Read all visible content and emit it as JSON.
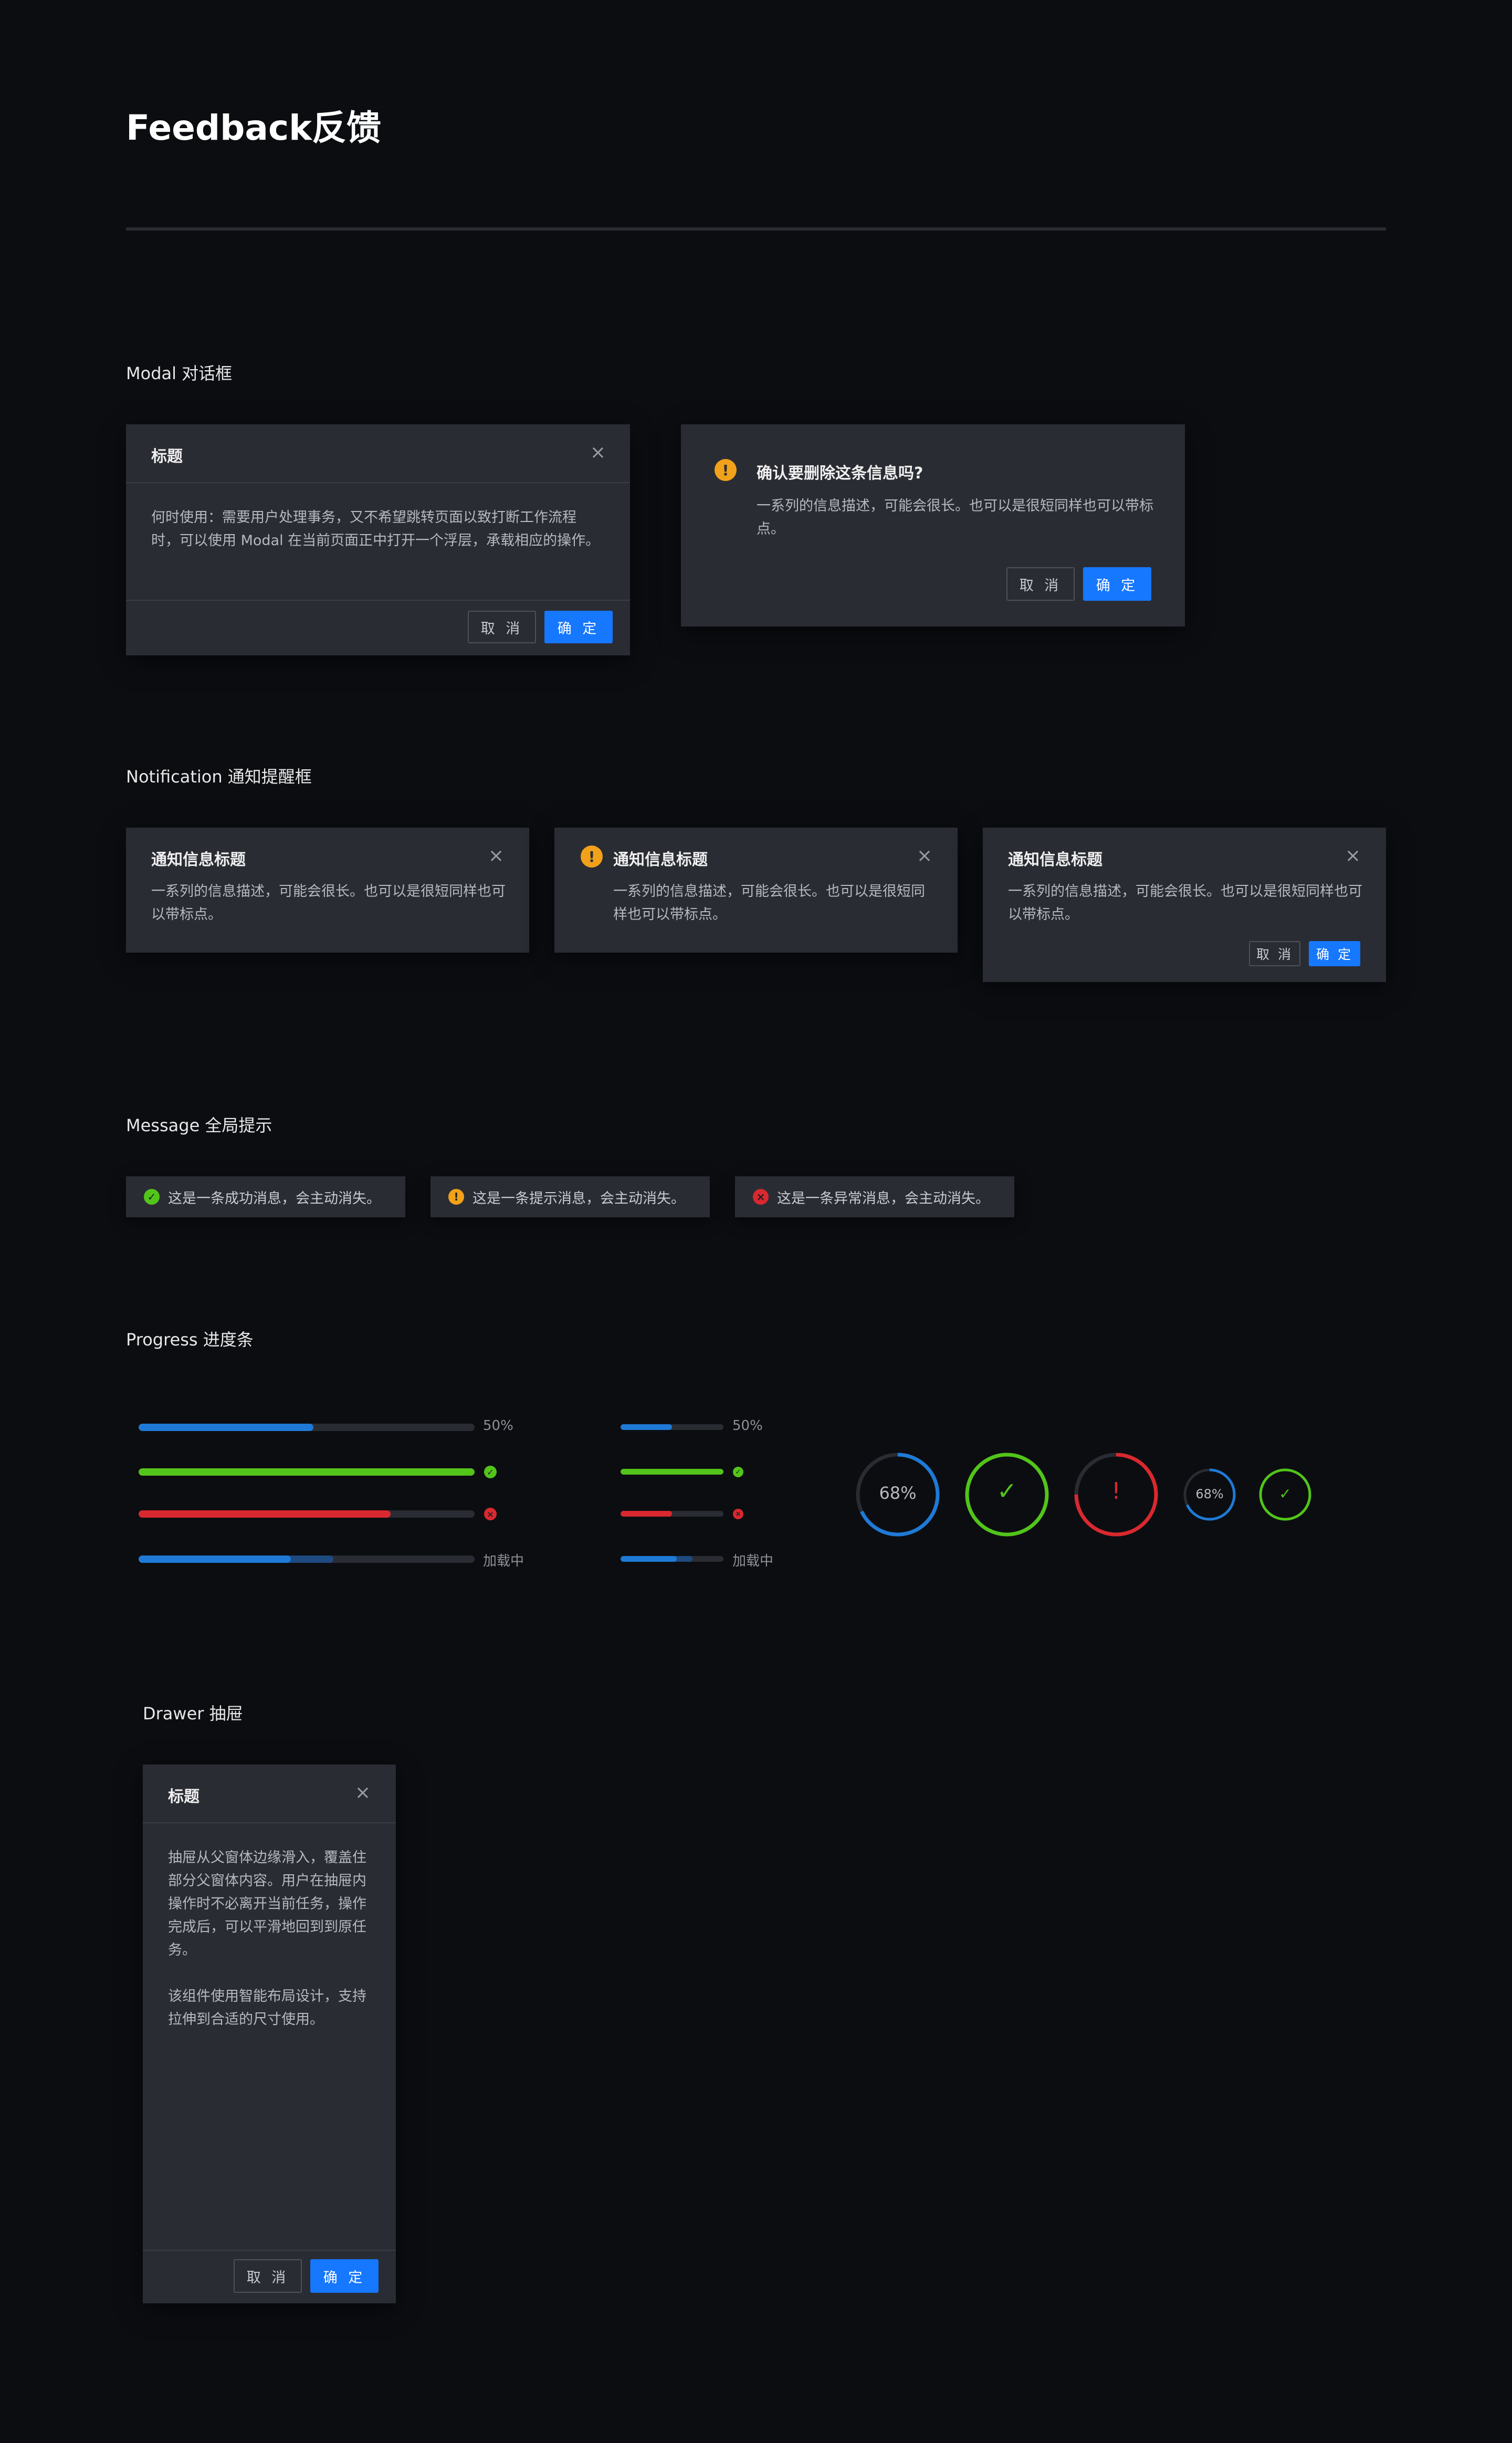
{
  "page": {
    "title": "Feedback反馈"
  },
  "colors": {
    "primary": "#1677ff",
    "success": "#52c41a",
    "warning": "#f1a11a",
    "error": "#d9282f",
    "panel": "#2a2c33",
    "background": "#0b0d11"
  },
  "modal": {
    "section_title": "Modal 对话框",
    "basic": {
      "title": "标题",
      "close_icon": "close-icon",
      "body": "何时使用：需要用户处理事务，又不希望跳转页面以致打断工作流程时，可以使用 Modal 在当前页面正中打开一个浮层，承载相应的操作。",
      "cancel": "取 消",
      "ok": "确 定"
    },
    "confirm": {
      "icon": "warning-icon",
      "title": "确认要删除这条信息吗?",
      "body": "一系列的信息描述，可能会很长。也可以是很短同样也可以带标点。",
      "cancel": "取 消",
      "ok": "确 定"
    }
  },
  "notification": {
    "section_title": "Notification 通知提醒框",
    "items": [
      {
        "title": "通知信息标题",
        "body": "一系列的信息描述，可能会很长。也可以是很短同样也可以带标点。",
        "icon": ""
      },
      {
        "title": "通知信息标题",
        "body": "一系列的信息描述，可能会很长。也可以是很短同样也可以带标点。",
        "icon": "warning-icon"
      },
      {
        "title": "通知信息标题",
        "body": "一系列的信息描述，可能会很长。也可以是很短同样也可以带标点。",
        "icon": "",
        "cancel": "取 消",
        "ok": "确 定"
      }
    ]
  },
  "message": {
    "section_title": "Message 全局提示",
    "items": [
      {
        "type": "success",
        "icon": "check-circle-icon",
        "text": "这是一条成功消息，会主动消失。"
      },
      {
        "type": "warning",
        "icon": "warning-icon",
        "text": "这是一条提示消息，会主动消失。"
      },
      {
        "type": "error",
        "icon": "close-circle-icon",
        "text": "这是一条异常消息，会主动消失。"
      }
    ]
  },
  "progress": {
    "section_title": "Progress 进度条",
    "lines": [
      {
        "percent": 50,
        "status": "normal",
        "label": "50%"
      },
      {
        "percent": 100,
        "status": "success",
        "label": ""
      },
      {
        "percent": 75,
        "status": "exception",
        "label": ""
      },
      {
        "percent": 45,
        "buffer": 58,
        "status": "active",
        "label": "加载中"
      }
    ],
    "small_lines": [
      {
        "percent": 50,
        "status": "normal",
        "label": "50%"
      },
      {
        "percent": 100,
        "status": "success",
        "label": ""
      },
      {
        "percent": 50,
        "status": "exception",
        "label": ""
      },
      {
        "percent": 55,
        "buffer": 70,
        "status": "active",
        "label": "加载中"
      }
    ],
    "circles": [
      {
        "percent": 68,
        "status": "normal",
        "label": "68%"
      },
      {
        "percent": 100,
        "status": "success",
        "label": "✓"
      },
      {
        "percent": 75,
        "status": "exception",
        "label": "!"
      },
      {
        "percent": 68,
        "status": "normal",
        "label": "68%"
      },
      {
        "percent": 100,
        "status": "success",
        "label": "✓"
      }
    ]
  },
  "drawer": {
    "section_title": "Drawer 抽屉",
    "title": "标题",
    "close_icon": "close-icon",
    "body1": "抽屉从父窗体边缘滑入，覆盖住部分父窗体内容。用户在抽屉内操作时不必离开当前任务，操作完成后，可以平滑地回到到原任务。",
    "body2": "该组件使用智能布局设计，支持拉伸到合适的尺寸使用。",
    "cancel": "取 消",
    "ok": "确 定"
  }
}
